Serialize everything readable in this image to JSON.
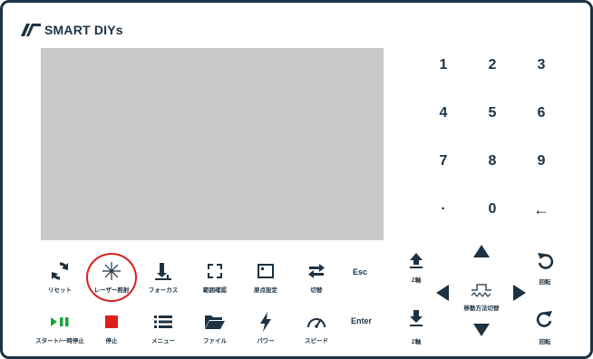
{
  "logo": {
    "brand": "SMART DIYs"
  },
  "keypad": {
    "keys": [
      "1",
      "2",
      "3",
      "4",
      "5",
      "6",
      "7",
      "8",
      "9",
      "·",
      "0",
      "←"
    ]
  },
  "controls": {
    "row1": [
      {
        "name": "reset",
        "label": "リセット",
        "icon": "reset-icon"
      },
      {
        "name": "laser-irradiation",
        "label": "レーザー照射",
        "icon": "laser-icon"
      },
      {
        "name": "focus",
        "label": "フォーカス",
        "icon": "focus-icon"
      },
      {
        "name": "range-check",
        "label": "範囲確認",
        "icon": "range-icon"
      },
      {
        "name": "origin-set",
        "label": "原点設定",
        "icon": "origin-icon"
      },
      {
        "name": "switch",
        "label": "切替",
        "icon": "swap-icon"
      }
    ],
    "row2": [
      {
        "name": "start-pause",
        "label": "スタート/一時停止",
        "icon": "play-pause-icon"
      },
      {
        "name": "stop",
        "label": "停止",
        "icon": "stop-icon"
      },
      {
        "name": "menu",
        "label": "メニュー",
        "icon": "menu-icon"
      },
      {
        "name": "file",
        "label": "ファイル",
        "icon": "folder-icon"
      },
      {
        "name": "power",
        "label": "パワー",
        "icon": "lightning-icon"
      },
      {
        "name": "speed",
        "label": "スピード",
        "icon": "speedometer-icon"
      }
    ],
    "esc_label": "Esc",
    "enter_label": "Enter"
  },
  "zaxis": {
    "up_label": "Z軸",
    "down_label": "Z軸"
  },
  "dpad": {
    "center_label": "移動方法切替"
  },
  "rotate": {
    "ccw_label": "回転",
    "cw_label": "回転"
  },
  "colors": {
    "primary": "#1d3242",
    "accent_green": "#1aa33a",
    "accent_red": "#e0201c",
    "highlight": "#d8201c",
    "screen": "#c9c9c9"
  }
}
